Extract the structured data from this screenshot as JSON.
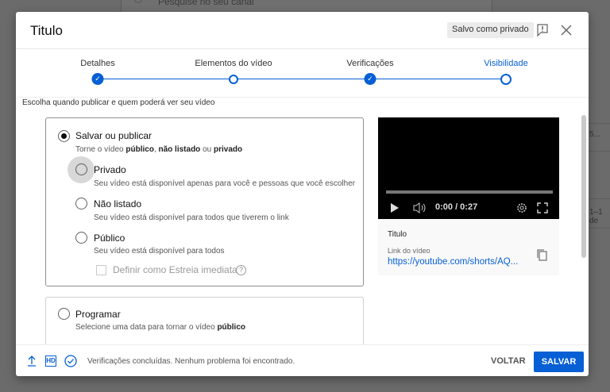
{
  "background": {
    "search_placeholder": "Pesquise no seu canal",
    "row_text_1": "5...",
    "row_text_2": "1–1 de"
  },
  "header": {
    "title": "Titulo",
    "status_badge": "Salvo como privado"
  },
  "stepper": {
    "steps": [
      {
        "label": "Detalhes",
        "state": "done"
      },
      {
        "label": "Elementos do vídeo",
        "state": "open"
      },
      {
        "label": "Verificações",
        "state": "done"
      },
      {
        "label": "Visibilidade",
        "state": "current"
      }
    ]
  },
  "visibility": {
    "intro": "Escolha quando publicar e quem poderá ver seu vídeo",
    "save_publish": {
      "label": "Salvar ou publicar",
      "selected": true,
      "desc_prefix": "Torne o vídeo ",
      "desc_b1": "público",
      "desc_sep": ", ",
      "desc_b2": "não listado",
      "desc_mid": " ou ",
      "desc_b3": "privado"
    },
    "options": [
      {
        "label": "Privado",
        "desc": "Seu vídeo está disponível apenas para você e pessoas que você escolher"
      },
      {
        "label": "Não listado",
        "desc": "Seu vídeo está disponível para todos que tiverem o link"
      },
      {
        "label": "Público",
        "desc": "Seu vídeo está disponível para todos"
      }
    ],
    "premiere_label": "Definir como Estreia imediata",
    "help": "?",
    "schedule": {
      "label": "Programar",
      "desc_prefix": "Selecione uma data para tornar o vídeo ",
      "desc_bold": "público"
    }
  },
  "preview": {
    "time": "0:00 / 0:27",
    "title_label": "Titulo",
    "link_label": "Link do vídeo",
    "link": "https://youtube.com/shorts/AQ..."
  },
  "footer": {
    "status": "Verificações concluídas. Nenhum problema foi encontrado.",
    "hd": "HD",
    "back": "VOLTAR",
    "save": "SALVAR"
  },
  "colors": {
    "accent": "#065fd4"
  }
}
